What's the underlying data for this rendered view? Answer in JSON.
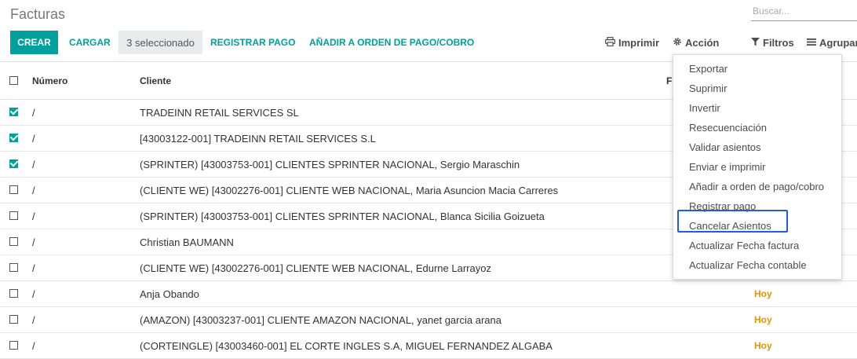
{
  "header": {
    "title": "Facturas",
    "search_placeholder": "Buscar..."
  },
  "toolbar": {
    "create_label": "CREAR",
    "upload_label": "CARGAR",
    "selected_label": "3 seleccionado",
    "register_payment_label": "REGISTRAR PAGO",
    "add_payment_order_label": "AÑADIR A ORDEN DE PAGO/COBRO",
    "print_label": "Imprimir",
    "action_label": "Acción",
    "filters_label": "Filtros",
    "group_label": "Agrupar"
  },
  "table": {
    "columns": {
      "number": "Número",
      "client": "Cliente",
      "date_fragment": "F"
    },
    "rows": [
      {
        "checked": true,
        "number": "/",
        "client": "TRADEINN RETAIL SERVICES SL",
        "date": ""
      },
      {
        "checked": true,
        "number": "/",
        "client": "[43003122-001] TRADEINN RETAIL SERVICES S.L",
        "date": ""
      },
      {
        "checked": true,
        "number": "/",
        "client": "(SPRINTER) [43003753-001] CLIENTES SPRINTER NACIONAL, Sergio Maraschin",
        "date": ""
      },
      {
        "checked": false,
        "number": "/",
        "client": "(CLIENTE WE) [43002276-001] CLIENTE WEB NACIONAL, Maria Asuncion Macia Carreres",
        "date": ""
      },
      {
        "checked": false,
        "number": "/",
        "client": "(SPRINTER) [43003753-001] CLIENTES SPRINTER NACIONAL, Blanca Sicilia Goizueta",
        "date": ""
      },
      {
        "checked": false,
        "number": "/",
        "client": "Christian BAUMANN",
        "date": ""
      },
      {
        "checked": false,
        "number": "/",
        "client": "(CLIENTE WE) [43002276-001] CLIENTE WEB NACIONAL, Edurne Larrayoz",
        "date": ""
      },
      {
        "checked": false,
        "number": "/",
        "client": "Anja Obando",
        "date": "Hoy"
      },
      {
        "checked": false,
        "number": "/",
        "client": "(AMAZON) [43003237-001] CLIENTE AMAZON NACIONAL, yanet garcia arana",
        "date": "Hoy"
      },
      {
        "checked": false,
        "number": "/",
        "client": "(CORTEINGLE) [43003460-001] EL CORTE INGLES S.A, MIGUEL FERNANDEZ ALGABA",
        "date": "Hoy"
      }
    ]
  },
  "action_menu": {
    "items": [
      "Exportar",
      "Suprimir",
      "Invertir",
      "Resecuenciación",
      "Validar asientos",
      "Enviar e imprimir",
      "Añadir a orden de pago/cobro",
      "Registrar pago",
      "Cancelar Asientos",
      "Actualizar Fecha factura",
      "Actualizar Fecha contable"
    ],
    "highlighted": "Cancelar Asientos"
  },
  "colors": {
    "accent": "#00a09d",
    "today": "#e79400",
    "highlight_border": "#1f5de0"
  }
}
